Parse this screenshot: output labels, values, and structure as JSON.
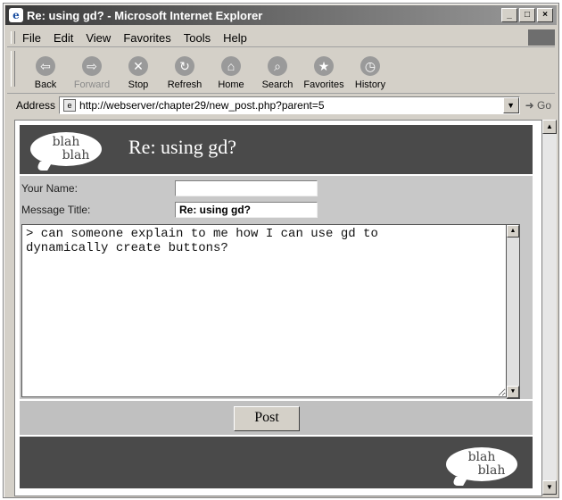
{
  "window": {
    "title": "Re: using gd? - Microsoft Internet Explorer",
    "buttons": [
      "_",
      "□",
      "×"
    ]
  },
  "menu": {
    "items": [
      "File",
      "Edit",
      "View",
      "Favorites",
      "Tools",
      "Help"
    ]
  },
  "toolbar": {
    "buttons": [
      {
        "label": "Back",
        "icon": "back-arrow-icon",
        "glyph": "⇦"
      },
      {
        "label": "Forward",
        "icon": "forward-arrow-icon",
        "glyph": "⇨"
      },
      {
        "label": "Stop",
        "icon": "stop-icon",
        "glyph": "✕"
      },
      {
        "label": "Refresh",
        "icon": "refresh-icon",
        "glyph": "↻"
      },
      {
        "label": "Home",
        "icon": "home-icon",
        "glyph": "⌂"
      },
      {
        "label": "Search",
        "icon": "search-icon",
        "glyph": "⌕"
      },
      {
        "label": "Favorites",
        "icon": "favorites-icon",
        "glyph": "★"
      },
      {
        "label": "History",
        "icon": "history-icon",
        "glyph": "◷"
      }
    ]
  },
  "address": {
    "label": "Address",
    "url": "http://webserver/chapter29/new_post.php?parent=5",
    "go_label": "Go"
  },
  "page": {
    "logo_line1": "blah",
    "logo_line2": "blah",
    "heading": "Re: using gd?",
    "form": {
      "name_label": "Your Name:",
      "name_value": "",
      "title_label": "Message Title:",
      "title_value": "Re: using gd?",
      "message_body": "> can someone explain to me how I can use gd to\ndynamically create buttons?"
    },
    "post_button": "Post",
    "footer_logo_line1": "blah",
    "footer_logo_line2": "blah"
  },
  "colors": {
    "banner": "#4a4a4a",
    "form_bg": "#c8c8c8",
    "chrome": "#d4d0c8"
  }
}
